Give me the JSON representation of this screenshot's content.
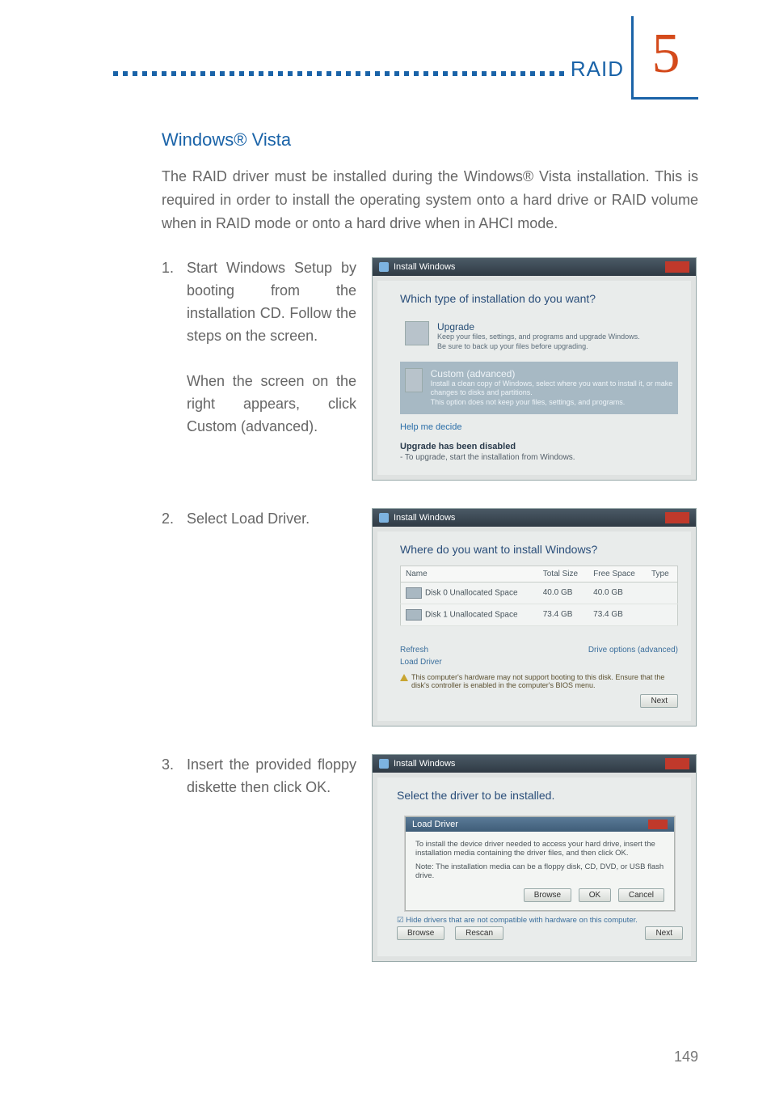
{
  "header": {
    "section_label": "RAID",
    "chapter_number": "5"
  },
  "section_title": "Windows® Vista",
  "intro_text": "The RAID driver must be installed during the Windows® Vista installation. This is required in order to install the operating system onto a hard drive or RAID volume when in RAID mode or onto a hard drive when in AHCI mode.",
  "steps": [
    {
      "number": "1.",
      "paragraphs": [
        "Start Windows Setup by booting from the installation CD. Follow the steps on the screen.",
        "When the screen on the right appears, click Custom (advanced)."
      ]
    },
    {
      "number": "2.",
      "paragraphs": [
        "Select Load Driver."
      ]
    },
    {
      "number": "3.",
      "paragraphs": [
        "Insert the provided floppy diskette then click OK."
      ]
    }
  ],
  "screenshot1": {
    "window_title": "Install Windows",
    "heading": "Which type of installation do you want?",
    "option_upgrade": {
      "title": "Upgrade",
      "sub1": "Keep your files, settings, and programs and upgrade Windows.",
      "sub2": "Be sure to back up your files before upgrading."
    },
    "option_custom": {
      "title": "Custom (advanced)",
      "sub1": "Install a clean copy of Windows, select where you want to install it, or make changes to disks and partitions.",
      "sub2": "This option does not keep your files, settings, and programs."
    },
    "help_link": "Help me decide",
    "disabled_heading": "Upgrade has been disabled",
    "disabled_sub": "- To upgrade, start the installation from Windows."
  },
  "screenshot2": {
    "window_title": "Install Windows",
    "heading": "Where do you want to install Windows?",
    "columns": {
      "name": "Name",
      "total": "Total Size",
      "free": "Free Space",
      "type": "Type"
    },
    "rows": [
      {
        "name": "Disk 0 Unallocated Space",
        "total": "40.0 GB",
        "free": "40.0 GB",
        "type": ""
      },
      {
        "name": "Disk 1 Unallocated Space",
        "total": "73.4 GB",
        "free": "73.4 GB",
        "type": ""
      }
    ],
    "refresh": "Refresh",
    "load_driver": "Load Driver",
    "drive_options": "Drive options (advanced)",
    "warning": "This computer's hardware may not support booting to this disk. Ensure that the disk's controller is enabled in the computer's BIOS menu.",
    "next_btn": "Next"
  },
  "screenshot3": {
    "window_title": "Install Windows",
    "heading": "Select the driver to be installed.",
    "dialog_title": "Load Driver",
    "dialog_text1": "To install the device driver needed to access your hard drive, insert the installation media containing the driver files, and then click OK.",
    "dialog_text2": "Note: The installation media can be a floppy disk, CD, DVD, or USB flash drive.",
    "browse_btn": "Browse",
    "ok_btn": "OK",
    "cancel_btn": "Cancel",
    "hide_check": "Hide drivers that are not compatible with hardware on this computer.",
    "browse2": "Browse",
    "rescan": "Rescan",
    "next_btn": "Next"
  },
  "page_number": "149"
}
